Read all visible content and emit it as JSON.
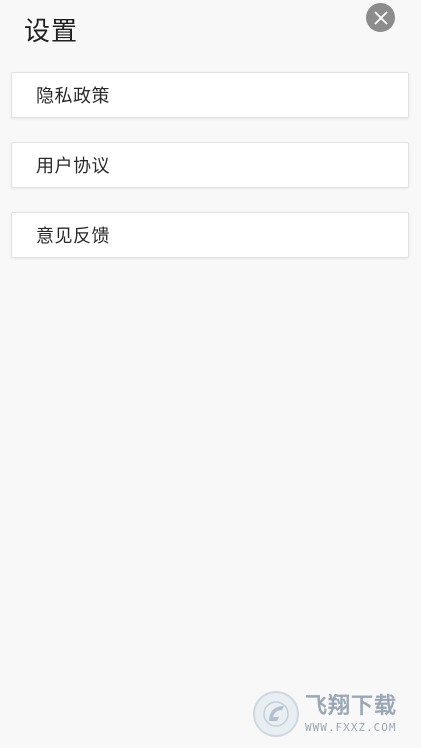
{
  "header": {
    "title": "设置",
    "close_icon": "close-icon"
  },
  "menu": {
    "items": [
      {
        "label": "隐私政策"
      },
      {
        "label": "用户协议"
      },
      {
        "label": "意见反馈"
      }
    ]
  },
  "watermark": {
    "brand_cn": "飞翔下载",
    "domain": "WWW.FXXZ.COM",
    "logo_icon": "fxxz-logo-icon"
  },
  "colors": {
    "background": "#f8f8f8",
    "card": "#ffffff",
    "close_button": "#8c8c8c",
    "watermark": "#9aa7b4"
  }
}
